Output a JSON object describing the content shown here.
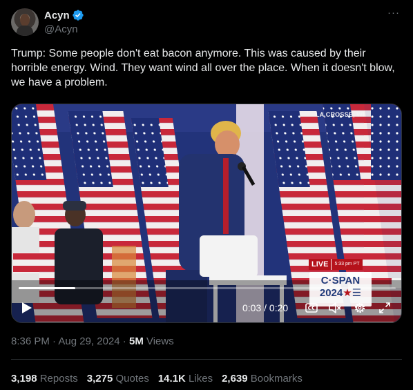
{
  "author": {
    "display_name": "Acyn",
    "handle": "@Acyn"
  },
  "tweet": {
    "text": "Trump: Some people don't eat bacon anymore. This was caused by their horrible energy. Wind. They want wind all over the place. When it doesn't blow, we have a problem."
  },
  "video": {
    "location_caption": "LA CROSSE, WI",
    "live_label": "LIVE",
    "live_time": "5:33 pm PT",
    "network_logo_line1": "C·SPAN",
    "network_logo_line2": "2024",
    "elapsed": "0:03",
    "separator": " / ",
    "duration": "0:20",
    "progress_fraction": 0.15
  },
  "meta": {
    "time": "8:36 PM",
    "dot1": " · ",
    "date": "Aug 29, 2024",
    "dot2": " · ",
    "views_count": "5M",
    "views_label": " Views"
  },
  "stats": {
    "reposts_count": "3,198",
    "reposts_label": "Reposts",
    "quotes_count": "3,275",
    "quotes_label": "Quotes",
    "likes_count": "14.1K",
    "likes_label": "Likes",
    "bookmarks_count": "2,639",
    "bookmarks_label": "Bookmarks"
  },
  "colors": {
    "verified_blue": "#1d9bf0",
    "text_primary": "#e7e9ea",
    "text_secondary": "#71767b"
  },
  "icons": [
    "verified-badge-icon",
    "more-options-icon",
    "play-icon",
    "closed-captions-icon",
    "mute-icon",
    "settings-gear-icon",
    "fullscreen-icon"
  ]
}
